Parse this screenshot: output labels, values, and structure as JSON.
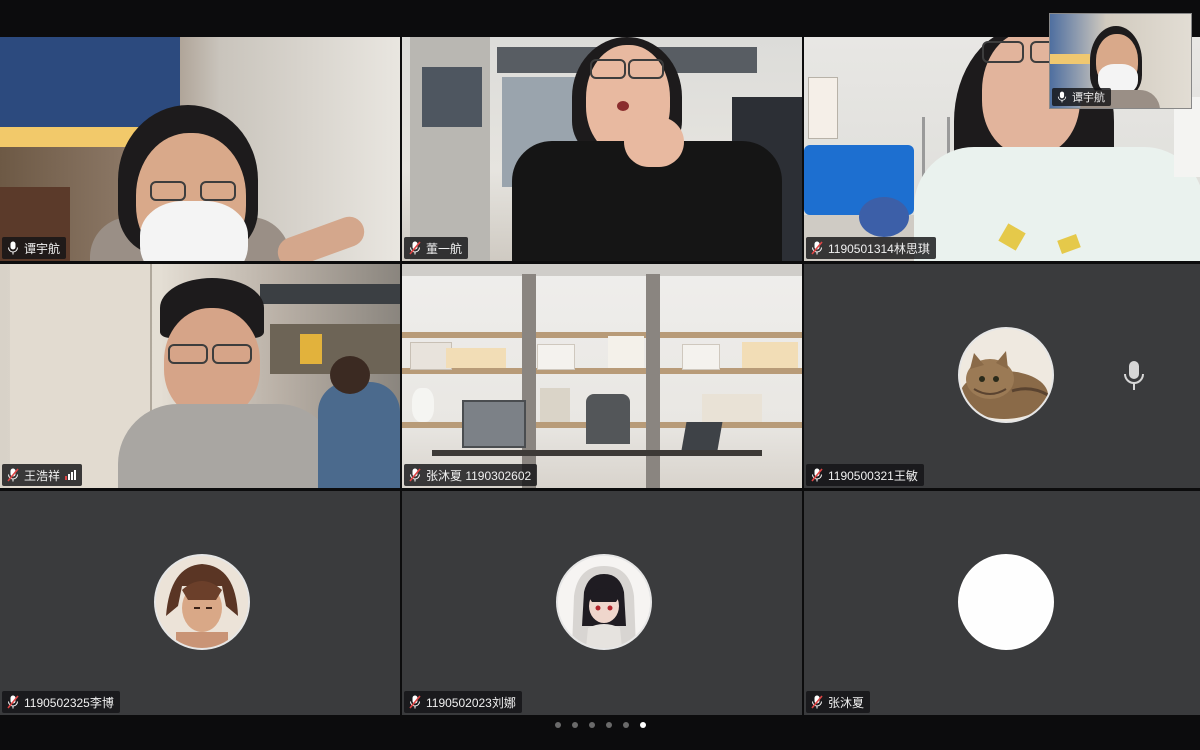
{
  "participants": [
    {
      "name": "谭宇航",
      "video": true
    },
    {
      "name": "董一航",
      "video": true
    },
    {
      "name": "1190501314林思琪",
      "video": true
    },
    {
      "name": "王浩祥",
      "video": true
    },
    {
      "name": "张沐夏 1190302602",
      "video": true
    },
    {
      "name": "1190500321王敏",
      "video": false,
      "avatar": "cat-avatar"
    },
    {
      "name": "1190502325李博",
      "video": false,
      "avatar": "anime-boy-avatar"
    },
    {
      "name": "1190502023刘娜",
      "video": false,
      "avatar": "anime-girl-avatar"
    },
    {
      "name": "张沐夏",
      "video": false,
      "avatar": "blank-avatar"
    }
  ],
  "self_view": {
    "name": "谭宇航"
  },
  "pager": {
    "pages": 6,
    "active": 6
  },
  "colors": {
    "tile_bg": "#3a3b3d",
    "mic_red": "#e04545",
    "screen_bg": "#0c0c0d"
  }
}
